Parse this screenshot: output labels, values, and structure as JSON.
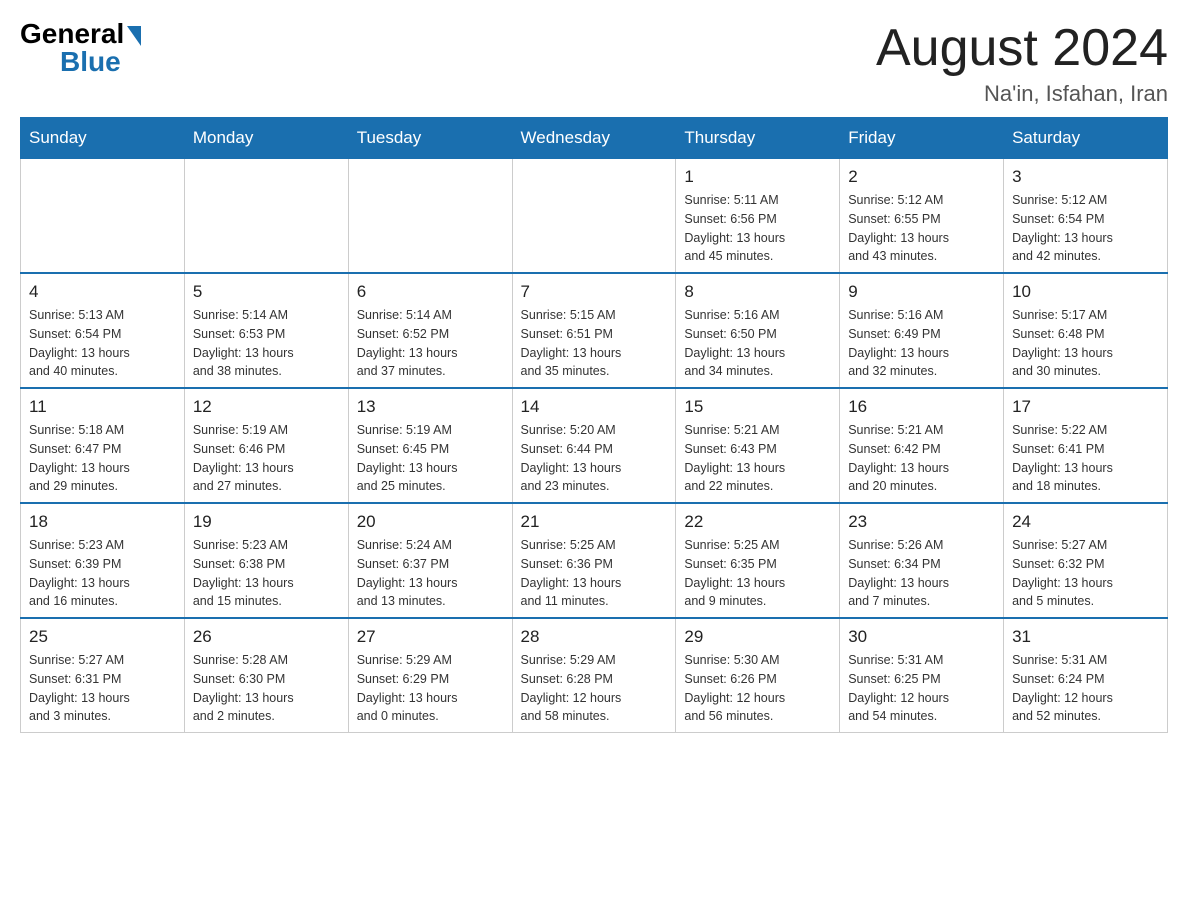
{
  "logo": {
    "general": "General",
    "blue": "Blue"
  },
  "header": {
    "month": "August 2024",
    "location": "Na'in, Isfahan, Iran"
  },
  "days_of_week": [
    "Sunday",
    "Monday",
    "Tuesday",
    "Wednesday",
    "Thursday",
    "Friday",
    "Saturday"
  ],
  "weeks": [
    [
      {
        "day": "",
        "info": ""
      },
      {
        "day": "",
        "info": ""
      },
      {
        "day": "",
        "info": ""
      },
      {
        "day": "",
        "info": ""
      },
      {
        "day": "1",
        "info": "Sunrise: 5:11 AM\nSunset: 6:56 PM\nDaylight: 13 hours\nand 45 minutes."
      },
      {
        "day": "2",
        "info": "Sunrise: 5:12 AM\nSunset: 6:55 PM\nDaylight: 13 hours\nand 43 minutes."
      },
      {
        "day": "3",
        "info": "Sunrise: 5:12 AM\nSunset: 6:54 PM\nDaylight: 13 hours\nand 42 minutes."
      }
    ],
    [
      {
        "day": "4",
        "info": "Sunrise: 5:13 AM\nSunset: 6:54 PM\nDaylight: 13 hours\nand 40 minutes."
      },
      {
        "day": "5",
        "info": "Sunrise: 5:14 AM\nSunset: 6:53 PM\nDaylight: 13 hours\nand 38 minutes."
      },
      {
        "day": "6",
        "info": "Sunrise: 5:14 AM\nSunset: 6:52 PM\nDaylight: 13 hours\nand 37 minutes."
      },
      {
        "day": "7",
        "info": "Sunrise: 5:15 AM\nSunset: 6:51 PM\nDaylight: 13 hours\nand 35 minutes."
      },
      {
        "day": "8",
        "info": "Sunrise: 5:16 AM\nSunset: 6:50 PM\nDaylight: 13 hours\nand 34 minutes."
      },
      {
        "day": "9",
        "info": "Sunrise: 5:16 AM\nSunset: 6:49 PM\nDaylight: 13 hours\nand 32 minutes."
      },
      {
        "day": "10",
        "info": "Sunrise: 5:17 AM\nSunset: 6:48 PM\nDaylight: 13 hours\nand 30 minutes."
      }
    ],
    [
      {
        "day": "11",
        "info": "Sunrise: 5:18 AM\nSunset: 6:47 PM\nDaylight: 13 hours\nand 29 minutes."
      },
      {
        "day": "12",
        "info": "Sunrise: 5:19 AM\nSunset: 6:46 PM\nDaylight: 13 hours\nand 27 minutes."
      },
      {
        "day": "13",
        "info": "Sunrise: 5:19 AM\nSunset: 6:45 PM\nDaylight: 13 hours\nand 25 minutes."
      },
      {
        "day": "14",
        "info": "Sunrise: 5:20 AM\nSunset: 6:44 PM\nDaylight: 13 hours\nand 23 minutes."
      },
      {
        "day": "15",
        "info": "Sunrise: 5:21 AM\nSunset: 6:43 PM\nDaylight: 13 hours\nand 22 minutes."
      },
      {
        "day": "16",
        "info": "Sunrise: 5:21 AM\nSunset: 6:42 PM\nDaylight: 13 hours\nand 20 minutes."
      },
      {
        "day": "17",
        "info": "Sunrise: 5:22 AM\nSunset: 6:41 PM\nDaylight: 13 hours\nand 18 minutes."
      }
    ],
    [
      {
        "day": "18",
        "info": "Sunrise: 5:23 AM\nSunset: 6:39 PM\nDaylight: 13 hours\nand 16 minutes."
      },
      {
        "day": "19",
        "info": "Sunrise: 5:23 AM\nSunset: 6:38 PM\nDaylight: 13 hours\nand 15 minutes."
      },
      {
        "day": "20",
        "info": "Sunrise: 5:24 AM\nSunset: 6:37 PM\nDaylight: 13 hours\nand 13 minutes."
      },
      {
        "day": "21",
        "info": "Sunrise: 5:25 AM\nSunset: 6:36 PM\nDaylight: 13 hours\nand 11 minutes."
      },
      {
        "day": "22",
        "info": "Sunrise: 5:25 AM\nSunset: 6:35 PM\nDaylight: 13 hours\nand 9 minutes."
      },
      {
        "day": "23",
        "info": "Sunrise: 5:26 AM\nSunset: 6:34 PM\nDaylight: 13 hours\nand 7 minutes."
      },
      {
        "day": "24",
        "info": "Sunrise: 5:27 AM\nSunset: 6:32 PM\nDaylight: 13 hours\nand 5 minutes."
      }
    ],
    [
      {
        "day": "25",
        "info": "Sunrise: 5:27 AM\nSunset: 6:31 PM\nDaylight: 13 hours\nand 3 minutes."
      },
      {
        "day": "26",
        "info": "Sunrise: 5:28 AM\nSunset: 6:30 PM\nDaylight: 13 hours\nand 2 minutes."
      },
      {
        "day": "27",
        "info": "Sunrise: 5:29 AM\nSunset: 6:29 PM\nDaylight: 13 hours\nand 0 minutes."
      },
      {
        "day": "28",
        "info": "Sunrise: 5:29 AM\nSunset: 6:28 PM\nDaylight: 12 hours\nand 58 minutes."
      },
      {
        "day": "29",
        "info": "Sunrise: 5:30 AM\nSunset: 6:26 PM\nDaylight: 12 hours\nand 56 minutes."
      },
      {
        "day": "30",
        "info": "Sunrise: 5:31 AM\nSunset: 6:25 PM\nDaylight: 12 hours\nand 54 minutes."
      },
      {
        "day": "31",
        "info": "Sunrise: 5:31 AM\nSunset: 6:24 PM\nDaylight: 12 hours\nand 52 minutes."
      }
    ]
  ]
}
